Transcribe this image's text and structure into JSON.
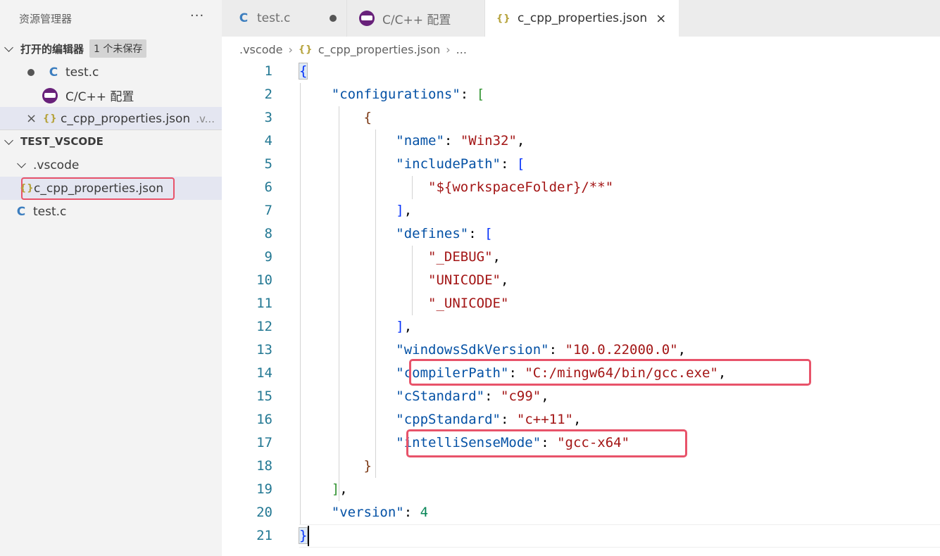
{
  "sidebar": {
    "title": "资源管理器",
    "more": "···",
    "open_editors": {
      "header": "打开的编辑器",
      "badge": "1 个未保存",
      "items": [
        {
          "label": "test.c",
          "icon": "c-file-icon",
          "dirty": true
        },
        {
          "label": "C/C++ 配置",
          "icon": "cpp-extension-icon"
        },
        {
          "label": "c_cpp_properties.json",
          "suffix": ".v...",
          "icon": "json-file-icon"
        }
      ]
    },
    "workspace": {
      "header": "TEST_VSCODE",
      "folder": ".vscode",
      "folder_file": "c_cpp_properties.json",
      "root_file": "test.c"
    }
  },
  "tabs": [
    {
      "label": "test.c",
      "icon_text": "C",
      "dirty": true
    },
    {
      "label": "C/C++ 配置"
    },
    {
      "label": "c_cpp_properties.json",
      "icon_text": "{}",
      "active": true
    }
  ],
  "breadcrumb": {
    "folder": ".vscode",
    "icon_text": "{}",
    "file": "c_cpp_properties.json",
    "more": "..."
  },
  "editor": {
    "line_numbers": [
      "1",
      "2",
      "3",
      "4",
      "5",
      "6",
      "7",
      "8",
      "9",
      "10",
      "11",
      "12",
      "13",
      "14",
      "15",
      "16",
      "17",
      "18",
      "19",
      "20",
      "21"
    ],
    "code": {
      "configurations_key": "\"configurations\"",
      "name_key": "\"name\"",
      "name_val": "\"Win32\"",
      "includePath_key": "\"includePath\"",
      "include_val": "\"${workspaceFolder}/**\"",
      "defines_key": "\"defines\"",
      "define1": "\"_DEBUG\"",
      "define2": "\"UNICODE\"",
      "define3": "\"_UNICODE\"",
      "sdk_key": "\"windowsSdkVersion\"",
      "sdk_val": "\"10.0.22000.0\"",
      "compiler_key": "\"compilerPath\"",
      "compiler_val": "\"C:/mingw64/bin/gcc.exe\"",
      "cstd_key": "\"cStandard\"",
      "cstd_val": "\"c99\"",
      "cppstd_key": "\"cppStandard\"",
      "cppstd_val": "\"c++11\"",
      "intelli_key": "\"intelliSenseMode\"",
      "intelli_val": "\"gcc-x64\"",
      "version_key": "\"version\"",
      "version_val": "4"
    }
  },
  "colors": {
    "highlight_box": "#e8536a",
    "key": "#0451a5",
    "string": "#a31515",
    "number": "#098658",
    "line_number": "#237893"
  }
}
